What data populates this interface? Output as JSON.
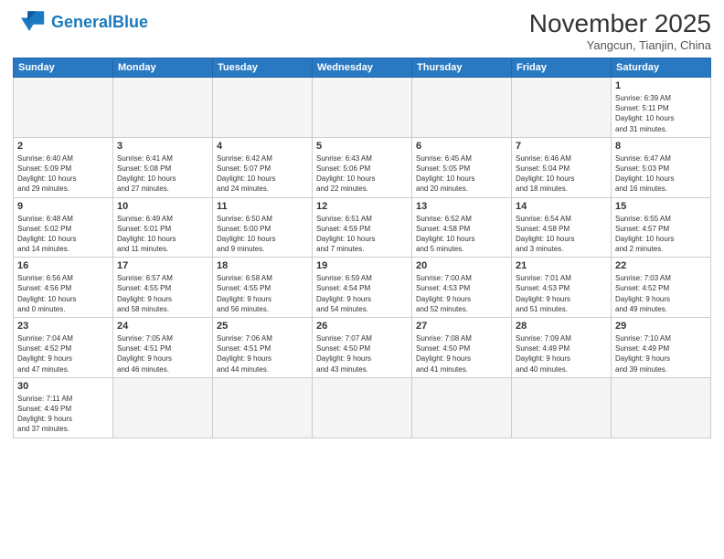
{
  "header": {
    "logo_general": "General",
    "logo_blue": "Blue",
    "month_title": "November 2025",
    "location": "Yangcun, Tianjin, China"
  },
  "days_of_week": [
    "Sunday",
    "Monday",
    "Tuesday",
    "Wednesday",
    "Thursday",
    "Friday",
    "Saturday"
  ],
  "weeks": [
    [
      {
        "day": "",
        "info": ""
      },
      {
        "day": "",
        "info": ""
      },
      {
        "day": "",
        "info": ""
      },
      {
        "day": "",
        "info": ""
      },
      {
        "day": "",
        "info": ""
      },
      {
        "day": "",
        "info": ""
      },
      {
        "day": "1",
        "info": "Sunrise: 6:39 AM\nSunset: 5:11 PM\nDaylight: 10 hours\nand 31 minutes."
      }
    ],
    [
      {
        "day": "2",
        "info": "Sunrise: 6:40 AM\nSunset: 5:09 PM\nDaylight: 10 hours\nand 29 minutes."
      },
      {
        "day": "3",
        "info": "Sunrise: 6:41 AM\nSunset: 5:08 PM\nDaylight: 10 hours\nand 27 minutes."
      },
      {
        "day": "4",
        "info": "Sunrise: 6:42 AM\nSunset: 5:07 PM\nDaylight: 10 hours\nand 24 minutes."
      },
      {
        "day": "5",
        "info": "Sunrise: 6:43 AM\nSunset: 5:06 PM\nDaylight: 10 hours\nand 22 minutes."
      },
      {
        "day": "6",
        "info": "Sunrise: 6:45 AM\nSunset: 5:05 PM\nDaylight: 10 hours\nand 20 minutes."
      },
      {
        "day": "7",
        "info": "Sunrise: 6:46 AM\nSunset: 5:04 PM\nDaylight: 10 hours\nand 18 minutes."
      },
      {
        "day": "8",
        "info": "Sunrise: 6:47 AM\nSunset: 5:03 PM\nDaylight: 10 hours\nand 16 minutes."
      }
    ],
    [
      {
        "day": "9",
        "info": "Sunrise: 6:48 AM\nSunset: 5:02 PM\nDaylight: 10 hours\nand 14 minutes."
      },
      {
        "day": "10",
        "info": "Sunrise: 6:49 AM\nSunset: 5:01 PM\nDaylight: 10 hours\nand 11 minutes."
      },
      {
        "day": "11",
        "info": "Sunrise: 6:50 AM\nSunset: 5:00 PM\nDaylight: 10 hours\nand 9 minutes."
      },
      {
        "day": "12",
        "info": "Sunrise: 6:51 AM\nSunset: 4:59 PM\nDaylight: 10 hours\nand 7 minutes."
      },
      {
        "day": "13",
        "info": "Sunrise: 6:52 AM\nSunset: 4:58 PM\nDaylight: 10 hours\nand 5 minutes."
      },
      {
        "day": "14",
        "info": "Sunrise: 6:54 AM\nSunset: 4:58 PM\nDaylight: 10 hours\nand 3 minutes."
      },
      {
        "day": "15",
        "info": "Sunrise: 6:55 AM\nSunset: 4:57 PM\nDaylight: 10 hours\nand 2 minutes."
      }
    ],
    [
      {
        "day": "16",
        "info": "Sunrise: 6:56 AM\nSunset: 4:56 PM\nDaylight: 10 hours\nand 0 minutes."
      },
      {
        "day": "17",
        "info": "Sunrise: 6:57 AM\nSunset: 4:55 PM\nDaylight: 9 hours\nand 58 minutes."
      },
      {
        "day": "18",
        "info": "Sunrise: 6:58 AM\nSunset: 4:55 PM\nDaylight: 9 hours\nand 56 minutes."
      },
      {
        "day": "19",
        "info": "Sunrise: 6:59 AM\nSunset: 4:54 PM\nDaylight: 9 hours\nand 54 minutes."
      },
      {
        "day": "20",
        "info": "Sunrise: 7:00 AM\nSunset: 4:53 PM\nDaylight: 9 hours\nand 52 minutes."
      },
      {
        "day": "21",
        "info": "Sunrise: 7:01 AM\nSunset: 4:53 PM\nDaylight: 9 hours\nand 51 minutes."
      },
      {
        "day": "22",
        "info": "Sunrise: 7:03 AM\nSunset: 4:52 PM\nDaylight: 9 hours\nand 49 minutes."
      }
    ],
    [
      {
        "day": "23",
        "info": "Sunrise: 7:04 AM\nSunset: 4:52 PM\nDaylight: 9 hours\nand 47 minutes."
      },
      {
        "day": "24",
        "info": "Sunrise: 7:05 AM\nSunset: 4:51 PM\nDaylight: 9 hours\nand 46 minutes."
      },
      {
        "day": "25",
        "info": "Sunrise: 7:06 AM\nSunset: 4:51 PM\nDaylight: 9 hours\nand 44 minutes."
      },
      {
        "day": "26",
        "info": "Sunrise: 7:07 AM\nSunset: 4:50 PM\nDaylight: 9 hours\nand 43 minutes."
      },
      {
        "day": "27",
        "info": "Sunrise: 7:08 AM\nSunset: 4:50 PM\nDaylight: 9 hours\nand 41 minutes."
      },
      {
        "day": "28",
        "info": "Sunrise: 7:09 AM\nSunset: 4:49 PM\nDaylight: 9 hours\nand 40 minutes."
      },
      {
        "day": "29",
        "info": "Sunrise: 7:10 AM\nSunset: 4:49 PM\nDaylight: 9 hours\nand 39 minutes."
      }
    ],
    [
      {
        "day": "30",
        "info": "Sunrise: 7:11 AM\nSunset: 4:49 PM\nDaylight: 9 hours\nand 37 minutes."
      },
      {
        "day": "",
        "info": ""
      },
      {
        "day": "",
        "info": ""
      },
      {
        "day": "",
        "info": ""
      },
      {
        "day": "",
        "info": ""
      },
      {
        "day": "",
        "info": ""
      },
      {
        "day": "",
        "info": ""
      }
    ]
  ]
}
